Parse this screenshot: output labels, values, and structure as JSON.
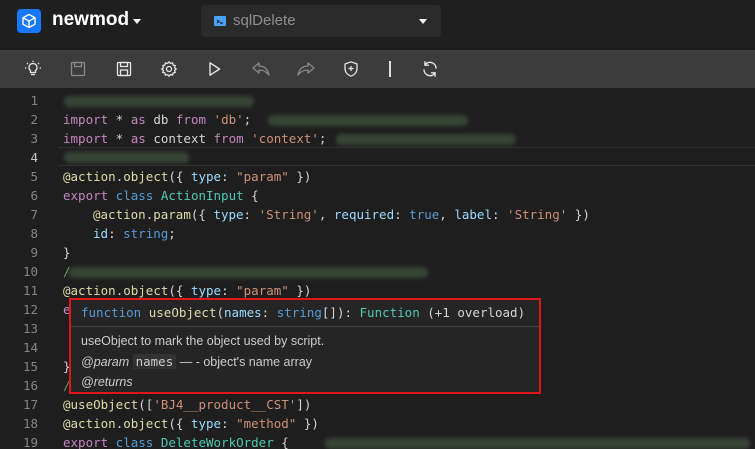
{
  "app": {
    "title": "newmod",
    "logo_icon": "cube-icon",
    "accent": "#1677ff"
  },
  "file_select": {
    "value": "sqlDelete",
    "icon": "code-file-icon"
  },
  "toolbar": {
    "buttons": [
      "lightbulb-icon",
      "save-icon",
      "save-all-icon",
      "gear-icon",
      "play-icon",
      "undo-icon",
      "redo-icon",
      "shield-icon",
      "refresh-icon"
    ]
  },
  "editor": {
    "lines": [
      "1",
      "2",
      "3",
      "4",
      "5",
      "6",
      "7",
      "8",
      "9",
      "10",
      "11",
      "12",
      "13",
      "14",
      "15",
      "16",
      "17",
      "18",
      "19"
    ],
    "active_line": "4",
    "code": {
      "l2_import": "import",
      "l2_star": " * ",
      "l2_as": "as",
      "l2_name": " db ",
      "l2_from": "from",
      "l2_mod": "'db'",
      "l2_end": ";",
      "l3_import": "import",
      "l3_star": " * ",
      "l3_as": "as",
      "l3_name": " context ",
      "l3_from": "from",
      "l3_mod": "'context'",
      "l3_end": ";",
      "l5_at": "@",
      "l5_action": "action",
      "l5_dot": ".",
      "l5_obj": "object",
      "l5_open": "({ ",
      "l5_type": "type",
      "l5_colon": ": ",
      "l5_val": "\"param\"",
      "l5_close": " })",
      "l6_export": "export",
      "l6_class": " class ",
      "l6_name": "ActionInput",
      "l6_brace": " {",
      "l7_at": "@",
      "l7_action": "action",
      "l7_dot": ".",
      "l7_param": "param",
      "l7_open": "({ ",
      "l7_type": "type",
      "l7_c1": ": ",
      "l7_tval": "'String'",
      "l7_comma1": ", ",
      "l7_req": "required",
      "l7_c2": ": ",
      "l7_true": "true",
      "l7_comma2": ", ",
      "l7_label": "label",
      "l7_c3": ": ",
      "l7_lval": "'String'",
      "l7_close": " })",
      "l8_id": "id",
      "l8_colon": ": ",
      "l8_type": "string",
      "l8_end": ";",
      "l9_brace": "}",
      "l10_cm": "/",
      "l11_at": "@",
      "l11_action": "action",
      "l11_dot": ".",
      "l11_obj": "object",
      "l11_open": "({ ",
      "l11_type": "type",
      "l11_colon": ": ",
      "l11_val": "\"param\"",
      "l11_close": " })",
      "l12_e": "e",
      "l15_brace": "}",
      "l16_cm": "/",
      "l17_at": "@",
      "l17_fn": "useObject",
      "l17_open": "([",
      "l17_val": "'BJ4__product__CST'",
      "l17_close": "])",
      "l18_at": "@",
      "l18_action": "action",
      "l18_dot": ".",
      "l18_obj": "object",
      "l18_open": "({ ",
      "l18_type": "type",
      "l18_colon": ": ",
      "l18_val": "\"method\"",
      "l18_close": " })",
      "l19_export": "export",
      "l19_class": " class ",
      "l19_name": "DeleteWorkOrder",
      "l19_brace": " {"
    }
  },
  "hover": {
    "sig_function": "function",
    "sig_name": " useObject",
    "sig_open": "(",
    "sig_param": "names",
    "sig_colon": ": ",
    "sig_type": "string",
    "sig_arr": "[]",
    "sig_close": "): ",
    "sig_ret": "Function",
    "sig_overload": " (+1 overload)",
    "description": "useObject to mark the object used by script.",
    "param_tag": "@param",
    "param_name": "names",
    "param_desc": " — - object's name array",
    "returns_tag": "@returns",
    "border_color": "#e0161b"
  }
}
